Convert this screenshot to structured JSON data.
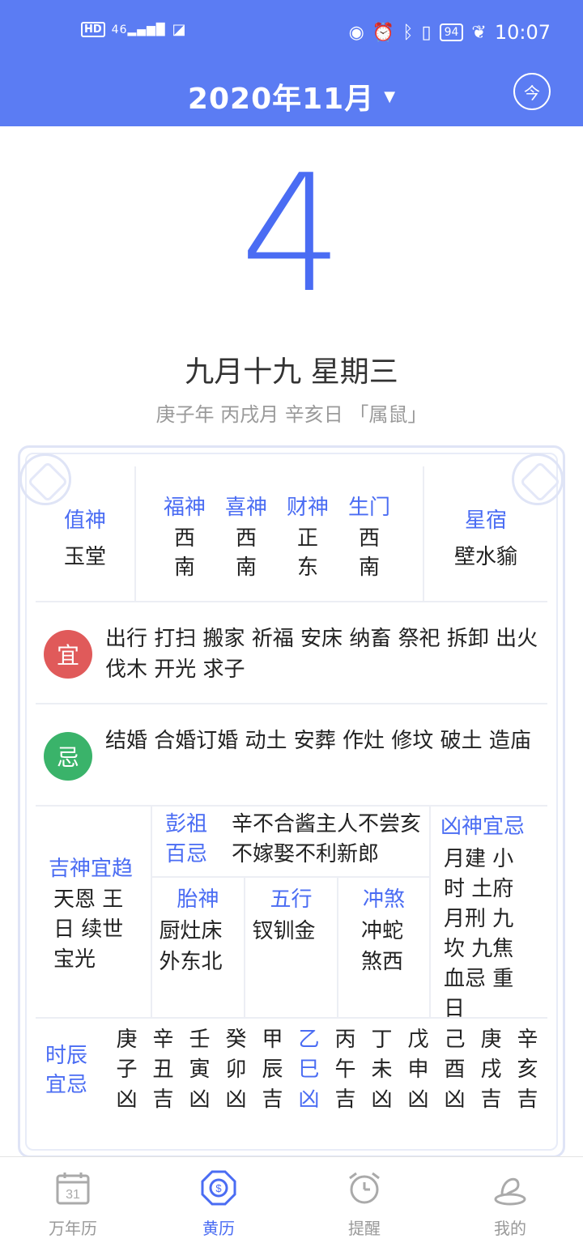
{
  "status_bar": {
    "hd": "HD",
    "signal": "46",
    "battery": "94",
    "time": "10:07"
  },
  "header": {
    "title": "2020年11月",
    "today_label": "今"
  },
  "date": {
    "day": "4",
    "lunar": "九月十九  星期三",
    "ganzhi": "庚子年 丙戌月 辛亥日 「属鼠」"
  },
  "almanac": {
    "zhishen": {
      "label": "值神",
      "value": "玉堂"
    },
    "gods": [
      {
        "label": "福神",
        "value": "西南"
      },
      {
        "label": "喜神",
        "value": "西南"
      },
      {
        "label": "财神",
        "value": "正东"
      },
      {
        "label": "生门",
        "value": "西南"
      }
    ],
    "xingxiu": {
      "label": "星宿",
      "value": "壁水貐"
    },
    "yi": {
      "badge": "宜",
      "text": "出行 打扫 搬家 祈福 安床 纳畜 祭祀 拆卸 出火 伐木 开光 求子"
    },
    "ji": {
      "badge": "忌",
      "text": "结婚 合婚订婚 动土 安葬 作灶 修坟 破土 造庙"
    },
    "jishen": {
      "label": "吉神宜趋",
      "text": "天恩 王日 续世 宝光"
    },
    "pengzu": {
      "label": "彭祖百忌",
      "text": "辛不合酱主人不尝亥不嫁娶不利新郎"
    },
    "taishen": {
      "label": "胎神",
      "text": "厨灶床外东北"
    },
    "wuxing": {
      "label": "五行",
      "text": "钗钏金"
    },
    "chongsha": {
      "label": "冲煞",
      "text": "冲蛇煞西"
    },
    "xiongshen": {
      "label": "凶神宜忌",
      "text": "月建 小时 土府 月刑 九坎 九焦 血忌 重日"
    },
    "shichen": {
      "label": "时辰宜忌",
      "hours": [
        {
          "a": "庚",
          "b": "子",
          "c": "凶"
        },
        {
          "a": "辛",
          "b": "丑",
          "c": "吉"
        },
        {
          "a": "壬",
          "b": "寅",
          "c": "凶"
        },
        {
          "a": "癸",
          "b": "卯",
          "c": "凶"
        },
        {
          "a": "甲",
          "b": "辰",
          "c": "吉"
        },
        {
          "a": "乙",
          "b": "巳",
          "c": "凶"
        },
        {
          "a": "丙",
          "b": "午",
          "c": "吉"
        },
        {
          "a": "丁",
          "b": "未",
          "c": "凶"
        },
        {
          "a": "戊",
          "b": "申",
          "c": "凶"
        },
        {
          "a": "己",
          "b": "酉",
          "c": "凶"
        },
        {
          "a": "庚",
          "b": "戌",
          "c": "吉"
        },
        {
          "a": "辛",
          "b": "亥",
          "c": "吉"
        }
      ]
    }
  },
  "nav": {
    "items": [
      {
        "label": "万年历",
        "icon": "calendar-icon",
        "icon_text": "31"
      },
      {
        "label": "黄历",
        "icon": "bagua-icon"
      },
      {
        "label": "提醒",
        "icon": "alarm-clock-icon"
      },
      {
        "label": "我的",
        "icon": "profile-icon"
      }
    ],
    "active_index": 1
  },
  "colors": {
    "accent": "#5b7cf3",
    "yi": "#e05a5a",
    "ji": "#3ab36a"
  }
}
